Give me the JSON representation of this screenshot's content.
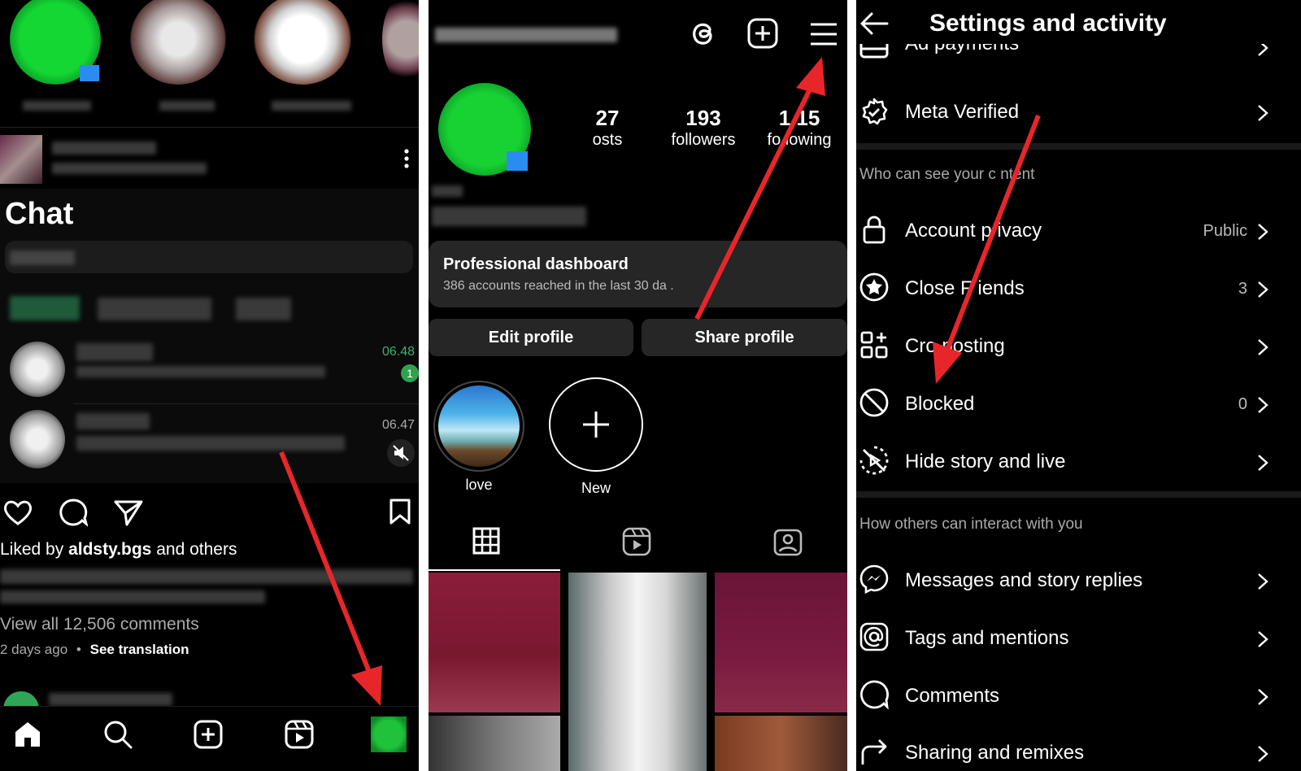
{
  "panel_feed": {
    "chat_title": "Chat",
    "chat_times": [
      "06.48",
      "06.47"
    ],
    "unread_badge": "1",
    "liked_prefix": "Liked by",
    "liked_user": "aldsty.bgs",
    "liked_suffix": "and others",
    "view_comments": "View all 12,506 comments",
    "posted_ago": "2 days ago",
    "see_translation": "See translation",
    "nav_icons": [
      "home-icon",
      "search-icon",
      "create-icon",
      "reels-icon",
      "profile-icon"
    ]
  },
  "panel_profile": {
    "stats": [
      {
        "value": "27",
        "label": "osts"
      },
      {
        "value": "193",
        "label": "followers"
      },
      {
        "value": "1 15",
        "label": "fo lowing"
      }
    ],
    "dashboard_title": "Professional dashboard",
    "dashboard_sub": "386 accounts reached in the last 30 da .",
    "edit_profile": "Edit profile",
    "share_profile": "Share profile",
    "highlights": [
      {
        "label": "love"
      },
      {
        "label": "New"
      }
    ],
    "tab_icons": [
      "grid-icon",
      "reels-icon",
      "tagged-icon"
    ]
  },
  "panel_settings": {
    "title": "Settings and activity",
    "partial_top": "Ad payments",
    "meta_verified": "Meta Verified",
    "section1": "Who can see your c ntent",
    "section2": "How others can interact with you",
    "rows1": [
      {
        "label": "Account p ivacy",
        "value": "Public",
        "icon": "lock-icon"
      },
      {
        "label": "Close F iends",
        "value": "3",
        "icon": "star-circle-icon"
      },
      {
        "label": "Cro posting",
        "value": "",
        "icon": "crossposting-icon"
      },
      {
        "label": "Blocked",
        "value": "0",
        "icon": "blocked-icon"
      },
      {
        "label": "Hide story and live",
        "value": "",
        "icon": "hide-story-icon"
      }
    ],
    "rows2": [
      {
        "label": "Messages and story replies",
        "icon": "messenger-icon"
      },
      {
        "label": "Tags and mentions",
        "icon": "at-icon"
      },
      {
        "label": "Comments",
        "icon": "comment-icon"
      },
      {
        "label": "Sharing and remixes",
        "icon": "share-icon"
      }
    ]
  },
  "colors": {
    "arrow": "#e8262a",
    "accent_green": "#1fc23a",
    "dark_card": "#262626",
    "badge_green": "#31a24c"
  }
}
